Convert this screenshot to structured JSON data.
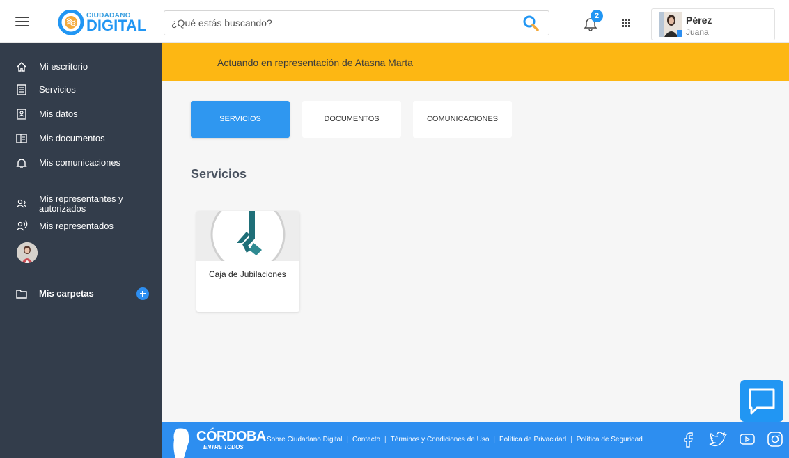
{
  "header": {
    "logo_small": "CIUDADANO",
    "logo_big": "DIGITAL",
    "search_placeholder": "¿Qué estás buscando?",
    "notification_count": "2",
    "user_name": "Pérez",
    "user_subname": "Juana"
  },
  "sidebar": {
    "items": [
      {
        "label": "Mi escritorio",
        "icon": "home-icon"
      },
      {
        "label": "Servicios",
        "icon": "services-icon"
      },
      {
        "label": "Mis datos",
        "icon": "id-card-icon"
      },
      {
        "label": "Mis documentos",
        "icon": "documents-icon"
      },
      {
        "label": "Mis comunicaciones",
        "icon": "bell-icon"
      }
    ],
    "representantes_line1": "Mis representantes y",
    "representantes_line2": "autorizados",
    "representados": "Mis representados",
    "folders": "Mis carpetas"
  },
  "banner": {
    "text": "Actuando en representación de Atasna Marta",
    "color": "#fdb713"
  },
  "main": {
    "tabs": [
      {
        "label": "SERVICIOS",
        "active": true
      },
      {
        "label": "DOCUMENTOS",
        "active": false
      },
      {
        "label": "COMUNICACIONES",
        "active": false
      }
    ],
    "section_title": "Servicios",
    "cards": [
      {
        "label": "Caja de Jubilaciones",
        "icon": "caja-jubilaciones-logo"
      }
    ]
  },
  "footer": {
    "brand": "CÓRDOBA",
    "brand_sub": "ENTRE TODOS",
    "links": [
      "Sobre Ciudadano Digital",
      "Contacto",
      "Términos y Condiciones de Uso",
      "Política de Privacidad",
      "Política de Seguridad"
    ],
    "social": [
      "facebook-icon",
      "twitter-icon",
      "youtube-icon",
      "instagram-icon"
    ]
  },
  "colors": {
    "accent": "#2196f3",
    "sidebar_bg": "#333d4b",
    "banner": "#fdb713",
    "footer": "#2d8ef0"
  }
}
